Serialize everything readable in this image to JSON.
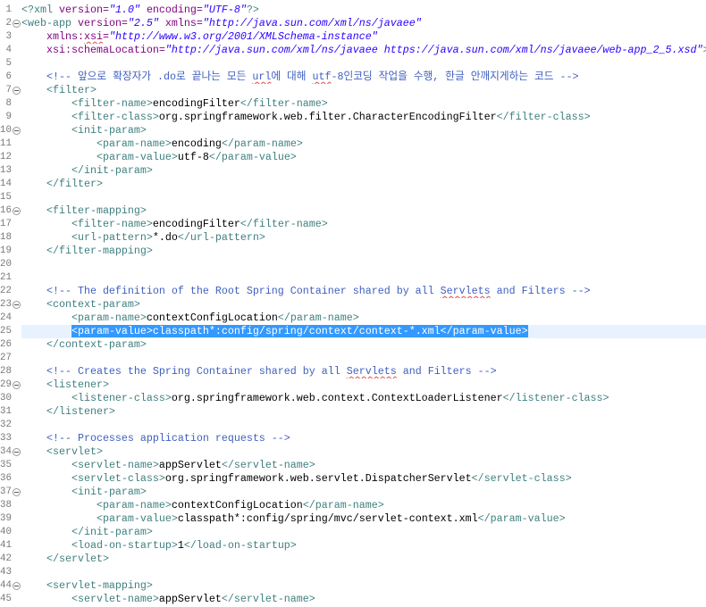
{
  "editor": {
    "colors": {
      "tag": "#3F7F7F",
      "attr": "#7F007F",
      "value": "#2A00FF",
      "comment": "#3F5FBF",
      "text": "#000000",
      "selection": "#3399FF",
      "current_line": "#E8F2FE",
      "line_number": "#787878",
      "spelling": "#E06060"
    },
    "lines": [
      {
        "n": 1,
        "fold": false,
        "t": [
          {
            "k": "tag",
            "v": "<?xml"
          },
          {
            "k": "ws",
            "v": " "
          },
          {
            "k": "attr",
            "v": "version="
          },
          {
            "k": "val",
            "v": "\"1.0\""
          },
          {
            "k": "ws",
            "v": " "
          },
          {
            "k": "attr",
            "v": "encoding="
          },
          {
            "k": "val",
            "v": "\"UTF-8\""
          },
          {
            "k": "tag",
            "v": "?>"
          }
        ]
      },
      {
        "n": 2,
        "fold": true,
        "t": [
          {
            "k": "tag",
            "v": "<web-app"
          },
          {
            "k": "ws",
            "v": " "
          },
          {
            "k": "attr",
            "v": "version="
          },
          {
            "k": "val",
            "v": "\"2.5\""
          },
          {
            "k": "ws",
            "v": " "
          },
          {
            "k": "attr",
            "v": "xmlns="
          },
          {
            "k": "val",
            "v": "\"http://java.sun.com/xml/ns/javaee\""
          }
        ]
      },
      {
        "n": 3,
        "fold": false,
        "t": [
          {
            "k": "ws",
            "v": "\t"
          },
          {
            "k": "attr",
            "v": "xmlns:"
          },
          {
            "k": "attr",
            "v": "xsi",
            "sq": true
          },
          {
            "k": "attr",
            "v": "="
          },
          {
            "k": "val",
            "v": "\"http://www.w3.org/2001/XMLSchema-instance\""
          }
        ]
      },
      {
        "n": 4,
        "fold": false,
        "t": [
          {
            "k": "ws",
            "v": "\t"
          },
          {
            "k": "attr",
            "v": "xsi:schemaLocation="
          },
          {
            "k": "val",
            "v": "\"http://java.sun.com/xml/ns/javaee https://java.sun.com/xml/ns/javaee/web-app_2_5.xsd\""
          },
          {
            "k": "tag",
            "v": ">"
          }
        ]
      },
      {
        "n": 5,
        "fold": false,
        "t": []
      },
      {
        "n": 6,
        "fold": false,
        "t": [
          {
            "k": "ws",
            "v": "\t"
          },
          {
            "k": "cmt",
            "v": "<!-- 앞으로 확장자가 .do로 끝나는 모든 "
          },
          {
            "k": "cmt",
            "v": "url",
            "sq": true
          },
          {
            "k": "cmt",
            "v": "에 대해 "
          },
          {
            "k": "cmt",
            "v": "utf",
            "sq": true
          },
          {
            "k": "cmt",
            "v": "-8인코딩 작업을 수행, 한글 안깨지게하는 코드 -->"
          }
        ]
      },
      {
        "n": 7,
        "fold": true,
        "t": [
          {
            "k": "ws",
            "v": "\t"
          },
          {
            "k": "tag",
            "v": "<filter>"
          }
        ]
      },
      {
        "n": 8,
        "fold": false,
        "t": [
          {
            "k": "ws",
            "v": "\t\t"
          },
          {
            "k": "tag",
            "v": "<filter-name>"
          },
          {
            "k": "txt",
            "v": "encodingFilter"
          },
          {
            "k": "tag",
            "v": "</filter-name>"
          }
        ]
      },
      {
        "n": 9,
        "fold": false,
        "t": [
          {
            "k": "ws",
            "v": "\t\t"
          },
          {
            "k": "tag",
            "v": "<filter-class>"
          },
          {
            "k": "txt",
            "v": "org.springframework.web.filter.CharacterEncodingFilter"
          },
          {
            "k": "tag",
            "v": "</filter-class>"
          }
        ]
      },
      {
        "n": 10,
        "fold": true,
        "t": [
          {
            "k": "ws",
            "v": "\t\t"
          },
          {
            "k": "tag",
            "v": "<init-param>"
          }
        ]
      },
      {
        "n": 11,
        "fold": false,
        "t": [
          {
            "k": "ws",
            "v": "\t\t\t"
          },
          {
            "k": "tag",
            "v": "<param-name>"
          },
          {
            "k": "txt",
            "v": "encoding"
          },
          {
            "k": "tag",
            "v": "</param-name>"
          }
        ]
      },
      {
        "n": 12,
        "fold": false,
        "t": [
          {
            "k": "ws",
            "v": "\t\t\t"
          },
          {
            "k": "tag",
            "v": "<param-value>"
          },
          {
            "k": "txt",
            "v": "utf-8"
          },
          {
            "k": "tag",
            "v": "</param-value>"
          }
        ]
      },
      {
        "n": 13,
        "fold": false,
        "t": [
          {
            "k": "ws",
            "v": "\t\t"
          },
          {
            "k": "tag",
            "v": "</init-param>"
          }
        ]
      },
      {
        "n": 14,
        "fold": false,
        "t": [
          {
            "k": "ws",
            "v": "\t"
          },
          {
            "k": "tag",
            "v": "</filter>"
          }
        ]
      },
      {
        "n": 15,
        "fold": false,
        "t": []
      },
      {
        "n": 16,
        "fold": true,
        "t": [
          {
            "k": "ws",
            "v": "\t"
          },
          {
            "k": "tag",
            "v": "<filter-mapping>"
          }
        ]
      },
      {
        "n": 17,
        "fold": false,
        "t": [
          {
            "k": "ws",
            "v": "\t\t"
          },
          {
            "k": "tag",
            "v": "<filter-name>"
          },
          {
            "k": "txt",
            "v": "encodingFilter"
          },
          {
            "k": "tag",
            "v": "</filter-name>"
          }
        ]
      },
      {
        "n": 18,
        "fold": false,
        "t": [
          {
            "k": "ws",
            "v": "\t\t"
          },
          {
            "k": "tag",
            "v": "<url-pattern>"
          },
          {
            "k": "txt",
            "v": "*.do"
          },
          {
            "k": "tag",
            "v": "</url-pattern>"
          }
        ]
      },
      {
        "n": 19,
        "fold": false,
        "t": [
          {
            "k": "ws",
            "v": "\t"
          },
          {
            "k": "tag",
            "v": "</filter-mapping>"
          }
        ]
      },
      {
        "n": 20,
        "fold": false,
        "t": []
      },
      {
        "n": 21,
        "fold": false,
        "t": []
      },
      {
        "n": 22,
        "fold": false,
        "t": [
          {
            "k": "ws",
            "v": "\t"
          },
          {
            "k": "cmt",
            "v": "<!-- The definition of the Root Spring Container shared by all "
          },
          {
            "k": "cmt",
            "v": "Servlets",
            "sq": true
          },
          {
            "k": "cmt",
            "v": " and Filters -->"
          }
        ]
      },
      {
        "n": 23,
        "fold": true,
        "t": [
          {
            "k": "ws",
            "v": "\t"
          },
          {
            "k": "tag",
            "v": "<context-param>"
          }
        ]
      },
      {
        "n": 24,
        "fold": false,
        "t": [
          {
            "k": "ws",
            "v": "\t\t"
          },
          {
            "k": "tag",
            "v": "<param-name>"
          },
          {
            "k": "txt",
            "v": "contextConfigLocation"
          },
          {
            "k": "tag",
            "v": "</param-name>"
          }
        ]
      },
      {
        "n": 25,
        "fold": false,
        "current": true,
        "t": [
          {
            "k": "ws",
            "v": "\t\t"
          },
          {
            "k": "tag",
            "v": "<param-value>",
            "sel": true
          },
          {
            "k": "txt",
            "v": "classpath*:config/spring/context/context-*.xml",
            "sel": true
          },
          {
            "k": "tag",
            "v": "</param-value>",
            "sel": true
          }
        ]
      },
      {
        "n": 26,
        "fold": false,
        "t": [
          {
            "k": "ws",
            "v": "\t"
          },
          {
            "k": "tag",
            "v": "</context-param>"
          }
        ]
      },
      {
        "n": 27,
        "fold": false,
        "t": []
      },
      {
        "n": 28,
        "fold": false,
        "t": [
          {
            "k": "ws",
            "v": "\t"
          },
          {
            "k": "cmt",
            "v": "<!-- Creates the Spring Container shared by all "
          },
          {
            "k": "cmt",
            "v": "Servlets",
            "sq": true
          },
          {
            "k": "cmt",
            "v": " and Filters -->"
          }
        ]
      },
      {
        "n": 29,
        "fold": true,
        "t": [
          {
            "k": "ws",
            "v": "\t"
          },
          {
            "k": "tag",
            "v": "<listener>"
          }
        ]
      },
      {
        "n": 30,
        "fold": false,
        "t": [
          {
            "k": "ws",
            "v": "\t\t"
          },
          {
            "k": "tag",
            "v": "<listener-class>"
          },
          {
            "k": "txt",
            "v": "org.springframework.web.context.ContextLoaderListener"
          },
          {
            "k": "tag",
            "v": "</listener-class>"
          }
        ]
      },
      {
        "n": 31,
        "fold": false,
        "t": [
          {
            "k": "ws",
            "v": "\t"
          },
          {
            "k": "tag",
            "v": "</listener>"
          }
        ]
      },
      {
        "n": 32,
        "fold": false,
        "t": []
      },
      {
        "n": 33,
        "fold": false,
        "t": [
          {
            "k": "ws",
            "v": "\t"
          },
          {
            "k": "cmt",
            "v": "<!-- Processes application requests -->"
          }
        ]
      },
      {
        "n": 34,
        "fold": true,
        "t": [
          {
            "k": "ws",
            "v": "\t"
          },
          {
            "k": "tag",
            "v": "<servlet>"
          }
        ]
      },
      {
        "n": 35,
        "fold": false,
        "t": [
          {
            "k": "ws",
            "v": "\t\t"
          },
          {
            "k": "tag",
            "v": "<servlet-name>"
          },
          {
            "k": "txt",
            "v": "appServlet"
          },
          {
            "k": "tag",
            "v": "</servlet-name>"
          }
        ]
      },
      {
        "n": 36,
        "fold": false,
        "t": [
          {
            "k": "ws",
            "v": "\t\t"
          },
          {
            "k": "tag",
            "v": "<servlet-class>"
          },
          {
            "k": "txt",
            "v": "org.springframework.web.servlet.DispatcherServlet"
          },
          {
            "k": "tag",
            "v": "</servlet-class>"
          }
        ]
      },
      {
        "n": 37,
        "fold": true,
        "t": [
          {
            "k": "ws",
            "v": "\t\t"
          },
          {
            "k": "tag",
            "v": "<init-param>"
          }
        ]
      },
      {
        "n": 38,
        "fold": false,
        "t": [
          {
            "k": "ws",
            "v": "\t\t\t"
          },
          {
            "k": "tag",
            "v": "<param-name>"
          },
          {
            "k": "txt",
            "v": "contextConfigLocation"
          },
          {
            "k": "tag",
            "v": "</param-name>"
          }
        ]
      },
      {
        "n": 39,
        "fold": false,
        "t": [
          {
            "k": "ws",
            "v": "\t\t\t"
          },
          {
            "k": "tag",
            "v": "<param-value>"
          },
          {
            "k": "txt",
            "v": "classpath*:config/spring/mvc/servlet-context.xml"
          },
          {
            "k": "tag",
            "v": "</param-value>"
          }
        ]
      },
      {
        "n": 40,
        "fold": false,
        "t": [
          {
            "k": "ws",
            "v": "\t\t"
          },
          {
            "k": "tag",
            "v": "</init-param>"
          }
        ]
      },
      {
        "n": 41,
        "fold": false,
        "t": [
          {
            "k": "ws",
            "v": "\t\t"
          },
          {
            "k": "tag",
            "v": "<load-on-startup>"
          },
          {
            "k": "txt",
            "v": "1"
          },
          {
            "k": "tag",
            "v": "</load-on-startup>"
          }
        ]
      },
      {
        "n": 42,
        "fold": false,
        "t": [
          {
            "k": "ws",
            "v": "\t"
          },
          {
            "k": "tag",
            "v": "</servlet>"
          }
        ]
      },
      {
        "n": 43,
        "fold": false,
        "t": []
      },
      {
        "n": 44,
        "fold": true,
        "t": [
          {
            "k": "ws",
            "v": "\t"
          },
          {
            "k": "tag",
            "v": "<servlet-mapping>"
          }
        ]
      },
      {
        "n": 45,
        "fold": false,
        "t": [
          {
            "k": "ws",
            "v": "\t\t"
          },
          {
            "k": "tag",
            "v": "<servlet-name>"
          },
          {
            "k": "txt",
            "v": "appServlet"
          },
          {
            "k": "tag",
            "v": "</servlet-name>"
          }
        ]
      }
    ]
  }
}
